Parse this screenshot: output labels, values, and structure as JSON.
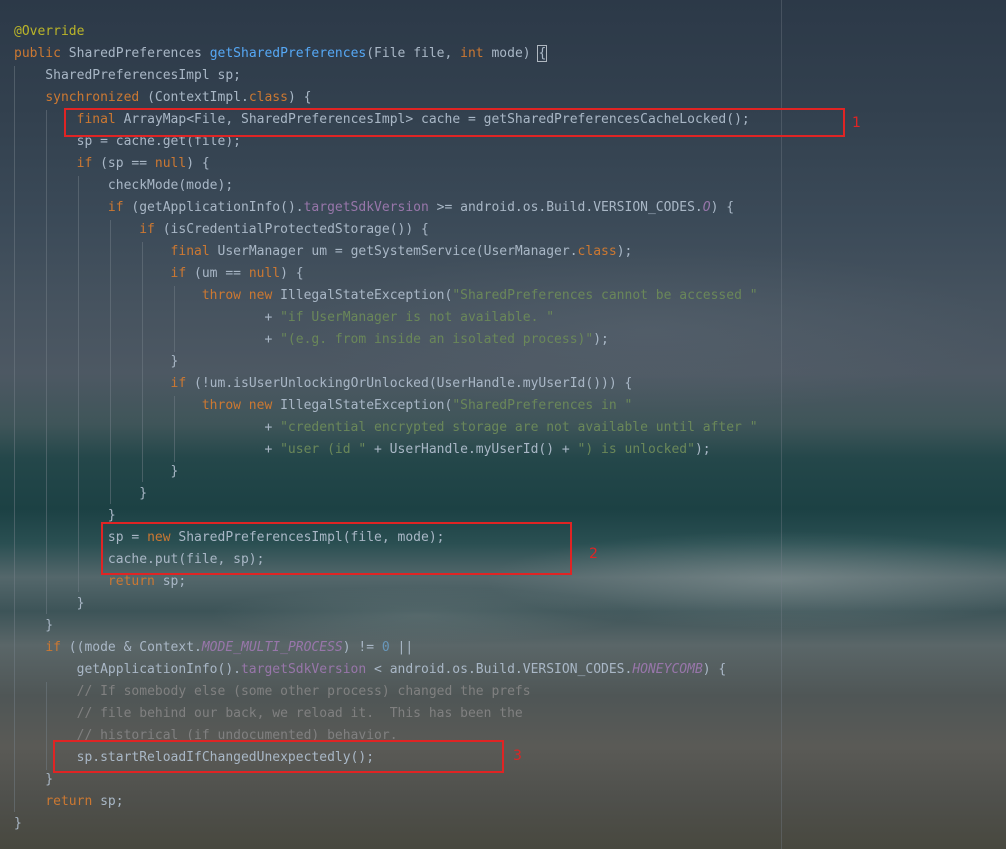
{
  "editor": {
    "lines": [
      {
        "id": "l1",
        "parts": [
          {
            "t": "@Override",
            "c": "an"
          }
        ]
      },
      {
        "id": "l2",
        "parts": [
          {
            "t": "public ",
            "c": "k"
          },
          {
            "t": "SharedPreferences "
          },
          {
            "t": "getSharedPreferences",
            "c": "fn"
          },
          {
            "t": "(File file, "
          },
          {
            "t": "int ",
            "c": "k"
          },
          {
            "t": "mode) "
          },
          {
            "t": "{",
            "c": "brace"
          }
        ]
      },
      {
        "id": "l3",
        "parts": [
          {
            "t": "    SharedPreferencesImpl sp;"
          }
        ]
      },
      {
        "id": "l4",
        "parts": [
          {
            "t": "    "
          },
          {
            "t": "synchronized ",
            "c": "k"
          },
          {
            "t": "(ContextImpl."
          },
          {
            "t": "class",
            "c": "k"
          },
          {
            "t": ") {"
          }
        ]
      },
      {
        "id": "l5",
        "parts": [
          {
            "t": "        "
          },
          {
            "t": "final ",
            "c": "k"
          },
          {
            "t": "ArrayMap<File, SharedPreferencesImpl> cache = getSharedPreferencesCacheLocked();"
          }
        ]
      },
      {
        "id": "l6",
        "parts": [
          {
            "t": "        sp = cache.get(file);"
          }
        ]
      },
      {
        "id": "l7",
        "parts": [
          {
            "t": "        "
          },
          {
            "t": "if ",
            "c": "k"
          },
          {
            "t": "(sp == "
          },
          {
            "t": "null",
            "c": "k"
          },
          {
            "t": ") {"
          }
        ]
      },
      {
        "id": "l8",
        "parts": [
          {
            "t": "            checkMode(mode);"
          }
        ]
      },
      {
        "id": "l9",
        "parts": [
          {
            "t": "            "
          },
          {
            "t": "if ",
            "c": "k"
          },
          {
            "t": "(getApplicationInfo()."
          },
          {
            "t": "targetSdkVersion",
            "c": "fld"
          },
          {
            "t": " >= android.os.Build.VERSION_CODES."
          },
          {
            "t": "O",
            "c": "cst"
          },
          {
            "t": ") {"
          }
        ]
      },
      {
        "id": "l10",
        "parts": [
          {
            "t": "                "
          },
          {
            "t": "if ",
            "c": "k"
          },
          {
            "t": "(isCredentialProtectedStorage()) {"
          }
        ]
      },
      {
        "id": "l11",
        "parts": [
          {
            "t": "                    "
          },
          {
            "t": "final ",
            "c": "k"
          },
          {
            "t": "UserManager um = getSystemService(UserManager."
          },
          {
            "t": "class",
            "c": "k"
          },
          {
            "t": ");"
          }
        ]
      },
      {
        "id": "l12",
        "parts": [
          {
            "t": "                    "
          },
          {
            "t": "if ",
            "c": "k"
          },
          {
            "t": "(um == "
          },
          {
            "t": "null",
            "c": "k"
          },
          {
            "t": ") {"
          }
        ]
      },
      {
        "id": "l13",
        "parts": [
          {
            "t": "                        "
          },
          {
            "t": "throw new ",
            "c": "k"
          },
          {
            "t": "IllegalStateException("
          },
          {
            "t": "\"SharedPreferences cannot be accessed \"",
            "c": "s"
          }
        ]
      },
      {
        "id": "l14",
        "parts": [
          {
            "t": "                                + "
          },
          {
            "t": "\"if UserManager is not available. \"",
            "c": "s"
          }
        ]
      },
      {
        "id": "l15",
        "parts": [
          {
            "t": "                                + "
          },
          {
            "t": "\"(e.g. from inside an isolated process)\"",
            "c": "s"
          },
          {
            "t": ");"
          }
        ]
      },
      {
        "id": "l16",
        "parts": [
          {
            "t": "                    }"
          }
        ]
      },
      {
        "id": "l17",
        "parts": [
          {
            "t": "                    "
          },
          {
            "t": "if ",
            "c": "k"
          },
          {
            "t": "(!um.isUserUnlockingOrUnlocked(UserHandle.myUserId())) {"
          }
        ]
      },
      {
        "id": "l18",
        "parts": [
          {
            "t": "                        "
          },
          {
            "t": "throw new ",
            "c": "k"
          },
          {
            "t": "IllegalStateException("
          },
          {
            "t": "\"SharedPreferences in \"",
            "c": "s"
          }
        ]
      },
      {
        "id": "l19",
        "parts": [
          {
            "t": "                                + "
          },
          {
            "t": "\"credential encrypted storage are not available until after \"",
            "c": "s"
          }
        ]
      },
      {
        "id": "l20",
        "parts": [
          {
            "t": "                                + "
          },
          {
            "t": "\"user (id \"",
            "c": "s"
          },
          {
            "t": " + UserHandle.myUserId() + "
          },
          {
            "t": "\") is unlocked\"",
            "c": "s"
          },
          {
            "t": ");"
          }
        ]
      },
      {
        "id": "l21",
        "parts": [
          {
            "t": "                    }"
          }
        ]
      },
      {
        "id": "l22",
        "parts": [
          {
            "t": "                }"
          }
        ]
      },
      {
        "id": "l23",
        "parts": [
          {
            "t": "            }"
          }
        ]
      },
      {
        "id": "l24",
        "parts": [
          {
            "t": "            sp = "
          },
          {
            "t": "new ",
            "c": "k"
          },
          {
            "t": "SharedPreferencesImpl(file, mode);"
          }
        ]
      },
      {
        "id": "l25",
        "parts": [
          {
            "t": "            cache.put(file, sp);"
          }
        ]
      },
      {
        "id": "l26",
        "parts": [
          {
            "t": "            "
          },
          {
            "t": "return ",
            "c": "k"
          },
          {
            "t": "sp;"
          }
        ]
      },
      {
        "id": "l27",
        "parts": [
          {
            "t": "        }"
          }
        ]
      },
      {
        "id": "l28",
        "parts": [
          {
            "t": "    }"
          }
        ]
      },
      {
        "id": "l29",
        "parts": [
          {
            "t": "    "
          },
          {
            "t": "if ",
            "c": "k"
          },
          {
            "t": "((mode & Context."
          },
          {
            "t": "MODE_MULTI_PROCESS",
            "c": "cst"
          },
          {
            "t": ") != "
          },
          {
            "t": "0",
            "c": "num"
          },
          {
            "t": " ||"
          }
        ]
      },
      {
        "id": "l30",
        "parts": [
          {
            "t": "        getApplicationInfo()."
          },
          {
            "t": "targetSdkVersion",
            "c": "fld"
          },
          {
            "t": " < android.os.Build.VERSION_CODES."
          },
          {
            "t": "HONEYCOMB",
            "c": "cst"
          },
          {
            "t": ") {"
          }
        ]
      },
      {
        "id": "l31",
        "parts": [
          {
            "t": "        "
          },
          {
            "t": "// If somebody else (some other process) changed the prefs",
            "c": "cm"
          }
        ]
      },
      {
        "id": "l32",
        "parts": [
          {
            "t": "        "
          },
          {
            "t": "// file behind our back, we reload it.  This has been the",
            "c": "cm"
          }
        ]
      },
      {
        "id": "l33",
        "parts": [
          {
            "t": "        "
          },
          {
            "t": "// historical (if undocumented) behavior.",
            "c": "cm"
          }
        ]
      },
      {
        "id": "l34",
        "parts": [
          {
            "t": "        sp.startReloadIfChangedUnexpectedly();"
          }
        ]
      },
      {
        "id": "l35",
        "parts": [
          {
            "t": "    }"
          }
        ]
      },
      {
        "id": "l36",
        "parts": [
          {
            "t": "    "
          },
          {
            "t": "return ",
            "c": "k"
          },
          {
            "t": "sp;"
          }
        ]
      },
      {
        "id": "l37",
        "parts": [
          {
            "t": "}"
          }
        ]
      }
    ]
  },
  "annotations": [
    {
      "label": "1"
    },
    {
      "label": "2"
    },
    {
      "label": "3"
    }
  ],
  "colors": {
    "keyword": "#cc7832",
    "annotation": "#bbb529",
    "method": "#56a8f5",
    "field": "#9876aa",
    "string": "#6a8759",
    "comment": "#808080",
    "number": "#6897bb",
    "text": "#a9b7c6",
    "highlight_box": "#e02424"
  }
}
